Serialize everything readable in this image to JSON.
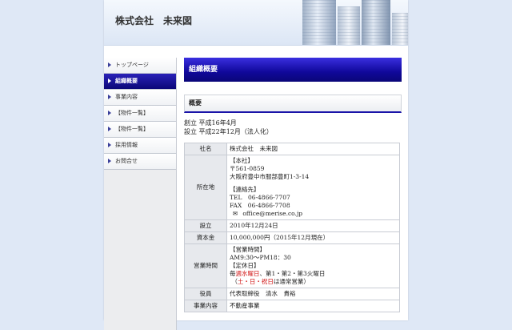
{
  "header": {
    "site_title": "株式会社　未来図"
  },
  "sidebar": {
    "items": [
      {
        "label": "トップページ",
        "active": false
      },
      {
        "label": "組織概要",
        "active": true
      },
      {
        "label": "事業内容",
        "active": false
      },
      {
        "label": "【物件一覧】",
        "active": false
      },
      {
        "label": "【物件一覧】",
        "active": false
      },
      {
        "label": "採用情報",
        "active": false
      },
      {
        "label": "お問合せ",
        "active": false
      }
    ]
  },
  "main": {
    "page_heading": "組織概要",
    "section_heading": "概要",
    "intro_line1": "創立 平成16年4月",
    "intro_line2": "設立 平成22年12月（法人化）",
    "table": {
      "company_name": {
        "label": "社名",
        "value": "株式会社　未来図"
      },
      "address": {
        "label": "所在地",
        "head_office": "【本社】",
        "postal": "〒561-0859",
        "street": "大阪府豊中市服部豊町1-3-14",
        "contact_heading": "【連絡先】",
        "tel": "TEL　06-4866-7707",
        "fax": "FAX　06-4866-7708",
        "email": "office@merise.co.jp"
      },
      "established": {
        "label": "設立",
        "value": "2010年12月24日"
      },
      "capital": {
        "label": "資本金",
        "value": "10,000,000円（2015年12月現在）"
      },
      "hours": {
        "label": "営業時間",
        "hours_heading": "【営業時間】",
        "hours_value": "AM9:30～PM18：30",
        "holiday_heading": "【定休日】",
        "holiday_pre": "毎",
        "holiday_red1": "週水曜日",
        "holiday_mid": "、第1・第2・第3火曜日",
        "holiday_open": "（",
        "holiday_red2": "土・日・祝日",
        "holiday_post": "は通常営業）"
      },
      "officers": {
        "label": "役員",
        "value": "代表取締役　清水　貴裕"
      },
      "business": {
        "label": "事業内容",
        "value": "不動産事業"
      }
    }
  },
  "colors": {
    "nav_active": "#0b0778",
    "heading_bar": "#10089a",
    "accent_red": "#d01010"
  }
}
